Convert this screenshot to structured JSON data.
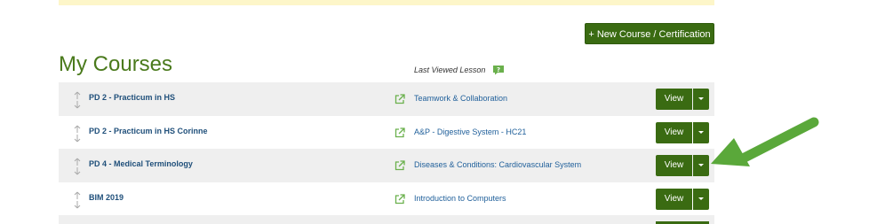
{
  "header": {
    "new_course_label": "+ New Course / Certification",
    "title": "My Courses",
    "last_viewed_label": "Last Viewed Lesson",
    "help_icon": "question-bubble-icon"
  },
  "courses": [
    {
      "name": "PD 2 - Practicum in HS",
      "lesson": "Teamwork & Collaboration",
      "view_label": "View"
    },
    {
      "name": "PD 2 - Practicum in HS Corinne",
      "lesson": "A&P - Digestive System - HC21",
      "view_label": "View"
    },
    {
      "name": "PD 4 - Medical Terminology",
      "lesson": "Diseases & Conditions: Cardiovascular System",
      "view_label": "View"
    },
    {
      "name": "BIM 2019",
      "lesson": "Introduction to Computers",
      "view_label": "View"
    }
  ],
  "colors": {
    "accent": "#3a6b12",
    "title": "#4a7a1c",
    "link": "#1f5f9a",
    "row_shade": "#efefef",
    "banner": "#fdf6c9",
    "arrow": "#5aa83a"
  }
}
